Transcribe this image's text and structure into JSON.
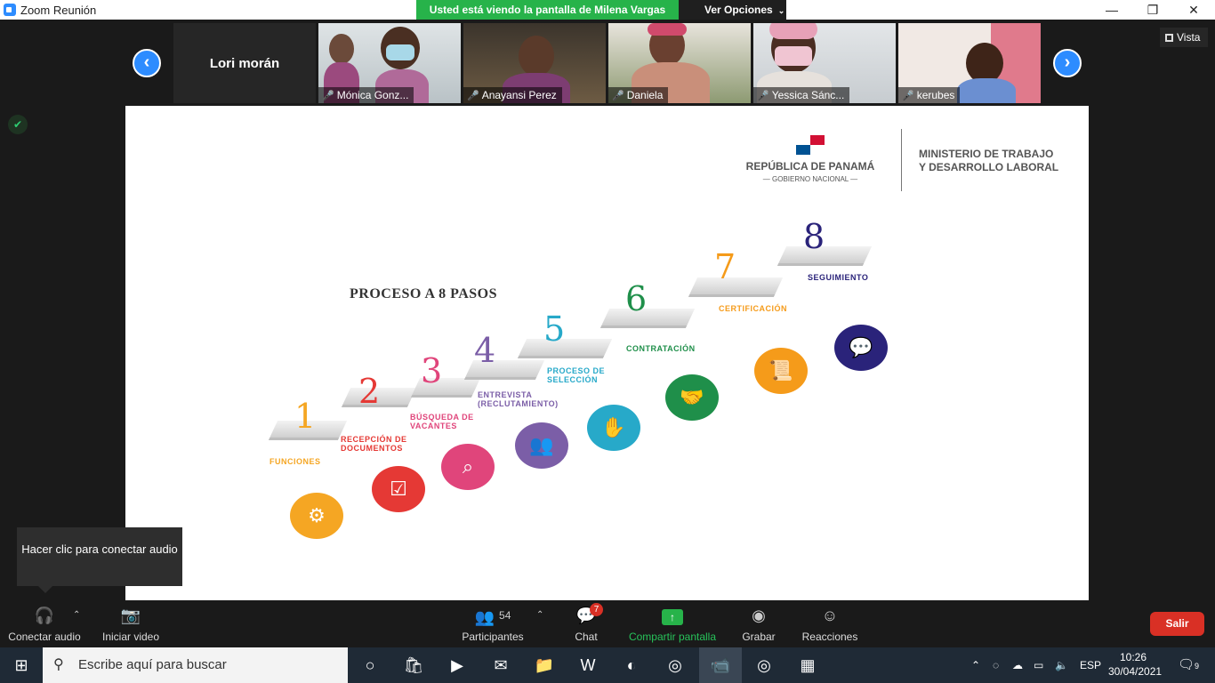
{
  "window": {
    "title": "Zoom Reunión",
    "share_banner": "Usted está viendo la pantalla de Milena Vargas",
    "view_options": "Ver Opciones",
    "minimize": "—",
    "restore": "❐",
    "close": "✕"
  },
  "gallery": {
    "prev": "‹",
    "next": "›",
    "active_speaker": "Lori morán",
    "participants": [
      {
        "name": "Mónica Gonz..."
      },
      {
        "name": "Anayansi Perez"
      },
      {
        "name": "Daniela"
      },
      {
        "name": "Yessica Sánc..."
      },
      {
        "name": "kerubes"
      }
    ],
    "view_label": "Vista"
  },
  "slide": {
    "republica": "REPÚBLICA DE PANAMÁ",
    "gobierno": "— GOBIERNO NACIONAL —",
    "ministerio_line1": "MINISTERIO DE TRABAJO",
    "ministerio_line2": "Y DESARROLLO LABORAL",
    "title": "PROCESO A 8 PASOS",
    "steps": [
      {
        "num": "1",
        "label": "FUNCIONES",
        "color": "#f5a623"
      },
      {
        "num": "2",
        "label": "RECEPCIÓN DE DOCUMENTOS",
        "color": "#e53935"
      },
      {
        "num": "3",
        "label": "BÚSQUEDA DE VACANTES",
        "color": "#e0457b"
      },
      {
        "num": "4",
        "label": "ENTREVISTA (RECLUTAMIENTO)",
        "color": "#7b5ea7"
      },
      {
        "num": "5",
        "label": "PROCESO DE SELECCIÓN",
        "color": "#27a9c9"
      },
      {
        "num": "6",
        "label": "CONTRATACIÓN",
        "color": "#1f8f4a"
      },
      {
        "num": "7",
        "label": "CERTIFICACIÓN",
        "color": "#f59b1a"
      },
      {
        "num": "8",
        "label": "SEGUIMIENTO",
        "color": "#2a237a"
      }
    ]
  },
  "tooltip": {
    "text": "Hacer clic para conectar audio"
  },
  "toolbar": {
    "audio": "Conectar audio",
    "video": "Iniciar video",
    "participants_count": "54",
    "participants": "Participantes",
    "chat": "Chat",
    "chat_badge": "7",
    "share": "Compartir pantalla",
    "record": "Grabar",
    "reactions": "Reacciones",
    "leave": "Salir"
  },
  "taskbar": {
    "search_placeholder": "Escribe aquí para buscar",
    "language": "ESP",
    "time": "10:26",
    "date": "30/04/2021",
    "notifications": "9"
  }
}
